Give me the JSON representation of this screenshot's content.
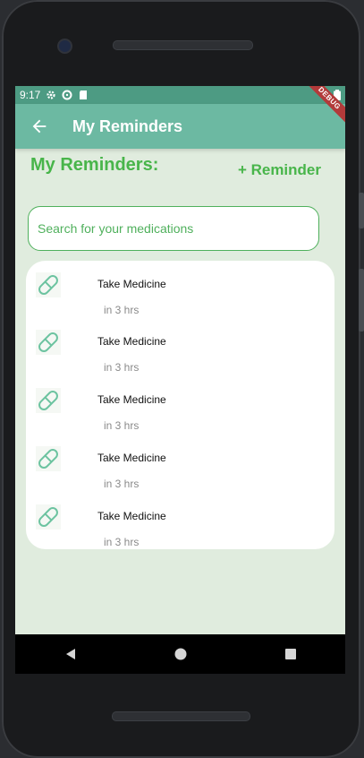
{
  "status_bar": {
    "time": "9:17",
    "debug_label": "DEBUG",
    "icons": [
      "gear-icon",
      "data-saver-icon",
      "sd-card-icon",
      "wifi-icon",
      "battery-icon"
    ]
  },
  "app_bar": {
    "title": "My Reminders",
    "back_icon": "arrow-left-icon"
  },
  "header": {
    "title": "My Reminders:",
    "add_label": "+ Reminder"
  },
  "search": {
    "placeholder": "Search for your medications"
  },
  "reminders": [
    {
      "title": "Take Medicine",
      "time": "in 3 hrs",
      "icon": "pill-icon"
    },
    {
      "title": "Take Medicine",
      "time": "in 3 hrs",
      "icon": "pill-icon"
    },
    {
      "title": "Take Medicine",
      "time": "in 3 hrs",
      "icon": "pill-icon"
    },
    {
      "title": "Take Medicine",
      "time": "in 3 hrs",
      "icon": "pill-icon"
    },
    {
      "title": "Take Medicine",
      "time": "in 3 hrs",
      "icon": "pill-icon"
    }
  ],
  "nav": [
    "back-triangle-icon",
    "home-circle-icon",
    "recents-square-icon"
  ],
  "colors": {
    "accent_green": "#48b54a",
    "appbar": "#6cb9a2",
    "statusbar": "#4d9b83",
    "background": "#e0ecde",
    "pill": "#6cc3a0"
  }
}
